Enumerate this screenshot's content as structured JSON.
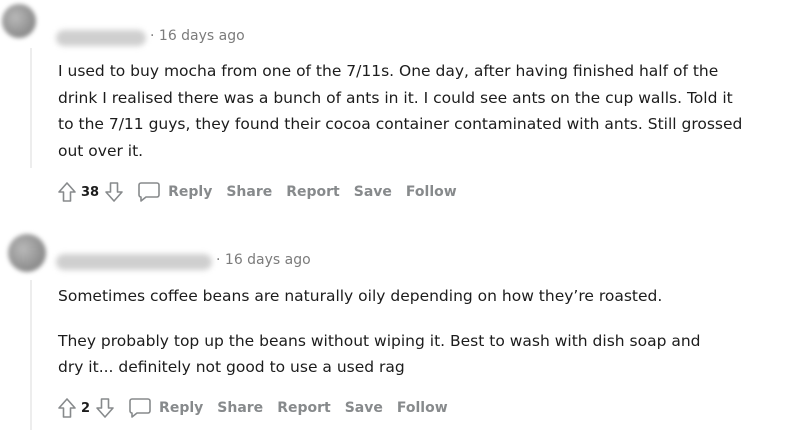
{
  "comments": [
    {
      "timestamp": "16 days ago",
      "body": [
        "I used to buy mocha from one of the 7/11s. One day, after having finished half of the drink I realised there was a bunch of ants in it. I could see ants on the cup walls. Told it to the 7/11 guys, they found their cocoa container contaminated with ants. Still grossed out over it."
      ],
      "votes": "38"
    },
    {
      "timestamp": "16 days ago",
      "body": [
        "Sometimes coffee beans are naturally oily depending on how they’re roasted.",
        "They probably top up the beans without wiping it. Best to wash with dish soap and dry it... definitely not good to use a used rag"
      ],
      "votes": "2"
    }
  ],
  "actions": {
    "reply": "Reply",
    "share": "Share",
    "report": "Report",
    "save": "Save",
    "follow": "Follow"
  },
  "separator": "·",
  "icons": {
    "upvote": "upvote-arrow-icon",
    "downvote": "downvote-arrow-icon",
    "reply": "speech-bubble-icon"
  },
  "colors": {
    "meta_text": "#7c7c7c",
    "action_text": "#878a8c",
    "body_text": "#1c1c1c"
  }
}
